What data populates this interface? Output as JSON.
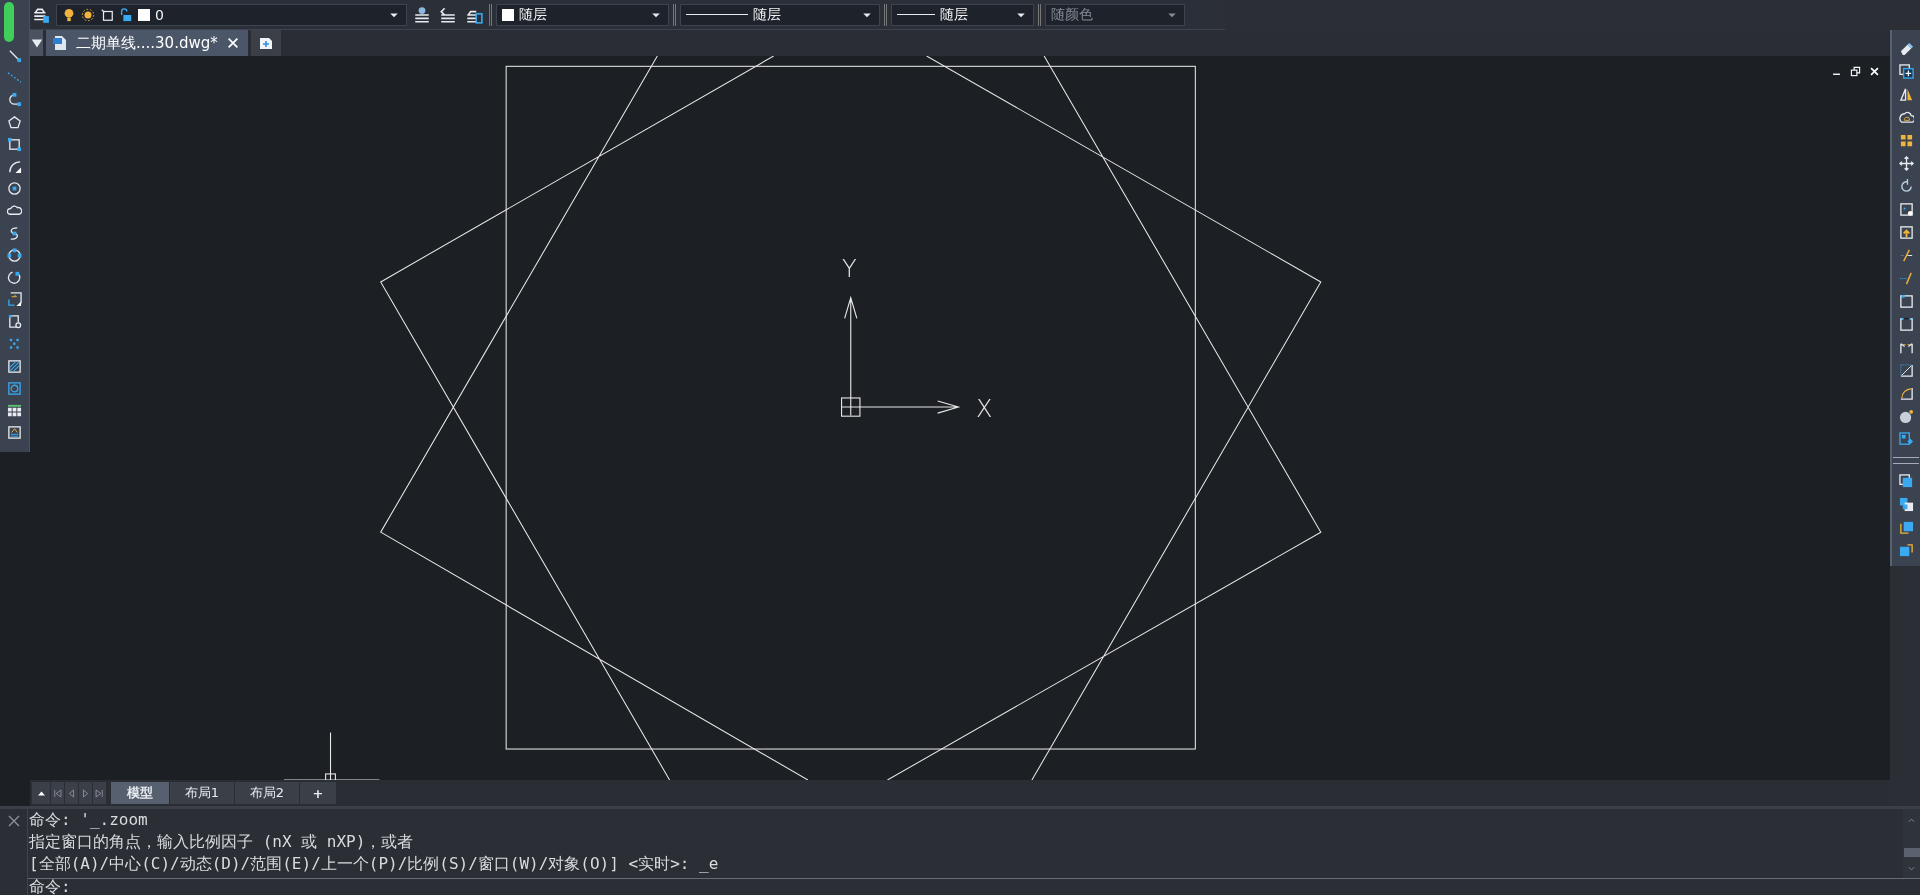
{
  "toolbar": {
    "layer_combo": {
      "value": "0"
    },
    "color_combo": {
      "value": "随层"
    },
    "linetype_combo": {
      "value": "随层"
    },
    "lineweight_combo": {
      "value": "随层"
    },
    "plotstyle_combo": {
      "value": "随颜色",
      "disabled": true
    }
  },
  "document_tabs": [
    {
      "label": "二期单线....30.dwg*",
      "selected": true
    }
  ],
  "ucs": {
    "y_label": "Y",
    "x_label": "X"
  },
  "layout_tabs": [
    {
      "kind": "tab",
      "label": "模型",
      "selected": true
    },
    {
      "kind": "tab",
      "label": "布局1",
      "selected": false
    },
    {
      "kind": "tab",
      "label": "布局2",
      "selected": false
    },
    {
      "kind": "add",
      "label": "+",
      "selected": false
    }
  ],
  "command": {
    "lines": [
      "命令: '_.zoom",
      "指定窗口的角点，输入比例因子 (nX 或 nXP)，或者",
      "[全部(A)/中心(C)/动态(D)/范围(E)/上一个(P)/比例(S)/窗口(W)/对象(O)] <实时>: _e"
    ],
    "prompt": "命令:"
  }
}
